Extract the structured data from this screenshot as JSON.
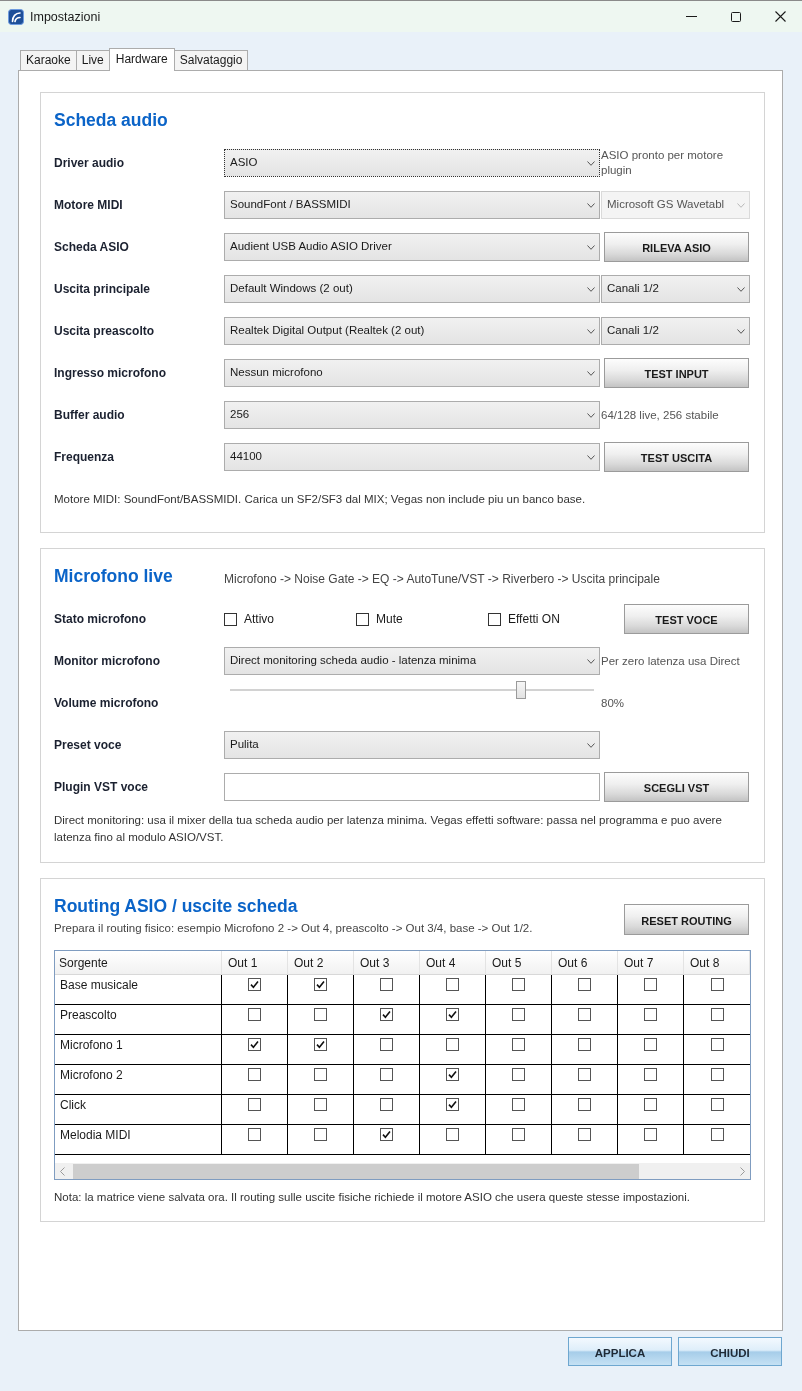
{
  "window": {
    "title": "Impostazioni"
  },
  "tabs": [
    {
      "label": "Karaoke",
      "selected": false
    },
    {
      "label": "Live",
      "selected": false
    },
    {
      "label": "Hardware",
      "selected": true
    },
    {
      "label": "Salvataggio",
      "selected": false
    }
  ],
  "sections": [
    {
      "kind": "form",
      "title": "Scheda audio",
      "rows": [
        {
          "label": "Driver audio",
          "control": {
            "kind": "dropdown",
            "value": "ASIO",
            "focused": true,
            "disabled": false
          },
          "side": {
            "kind": "note",
            "text": "ASIO pronto per motore plugin"
          }
        },
        {
          "label": "Motore MIDI",
          "control": {
            "kind": "dropdown",
            "value": "SoundFont / BASSMIDI",
            "focused": false,
            "disabled": false
          },
          "side": {
            "kind": "dropdown",
            "value": "Microsoft GS Wavetabl",
            "focused": false,
            "disabled": true
          }
        },
        {
          "label": "Scheda ASIO",
          "control": {
            "kind": "dropdown",
            "value": "Audient USB Audio ASIO Driver",
            "focused": false,
            "disabled": false
          },
          "side": {
            "kind": "button",
            "label": "RILEVA ASIO"
          }
        },
        {
          "label": "Uscita principale",
          "control": {
            "kind": "dropdown",
            "value": "Default Windows (2 out)",
            "focused": false,
            "disabled": false
          },
          "side": {
            "kind": "dropdown",
            "value": "Canali 1/2",
            "focused": false,
            "disabled": false
          }
        },
        {
          "label": "Uscita preascolto",
          "control": {
            "kind": "dropdown",
            "value": "Realtek Digital Output (Realtek (2 out)",
            "focused": false,
            "disabled": false
          },
          "side": {
            "kind": "dropdown",
            "value": "Canali 1/2",
            "focused": false,
            "disabled": false
          }
        },
        {
          "label": "Ingresso microfono",
          "control": {
            "kind": "dropdown",
            "value": "Nessun microfono",
            "focused": false,
            "disabled": false
          },
          "side": {
            "kind": "button",
            "label": "TEST INPUT"
          }
        },
        {
          "label": "Buffer audio",
          "control": {
            "kind": "dropdown",
            "value": "256",
            "focused": false,
            "disabled": false
          },
          "side": {
            "kind": "note",
            "text": "64/128 live, 256 stabile"
          }
        },
        {
          "label": "Frequenza",
          "control": {
            "kind": "dropdown",
            "value": "44100",
            "focused": false,
            "disabled": false
          },
          "side": {
            "kind": "button",
            "label": "TEST USCITA"
          }
        }
      ],
      "note": "Motore MIDI: SoundFont/BASSMIDI. Carica un SF2/SF3 dal MIX; Vegas non include piu un banco base."
    },
    {
      "kind": "form",
      "title": "Microfono live",
      "subtitle": "Microfono -> Noise Gate -> EQ -> AutoTune/VST -> Riverbero -> Uscita principale",
      "rows": [
        {
          "label": "Stato microfono",
          "control": {
            "kind": "checkboxes",
            "items": [
              {
                "label": "Attivo",
                "checked": false
              },
              {
                "label": "Mute",
                "checked": false
              },
              {
                "label": "Effetti ON",
                "checked": false
              }
            ]
          },
          "side": {
            "kind": "button",
            "label": "TEST VOCE"
          }
        },
        {
          "label": "Monitor microfono",
          "control": {
            "kind": "dropdown",
            "value": "Direct monitoring scheda audio - latenza minima",
            "focused": false,
            "disabled": false
          },
          "side": {
            "kind": "note",
            "text": "Per zero latenza usa Direct"
          }
        },
        {
          "label": "Volume microfono",
          "control": {
            "kind": "slider",
            "level": 0.8
          },
          "side": {
            "kind": "note",
            "text": "80%"
          }
        },
        {
          "label": "Preset voce",
          "control": {
            "kind": "dropdown",
            "value": "Pulita",
            "focused": false,
            "disabled": false
          }
        },
        {
          "label": "Plugin VST voce",
          "control": {
            "kind": "input"
          },
          "side": {
            "kind": "button",
            "label": "SCEGLI VST"
          }
        }
      ],
      "note": "Direct monitoring: usa il mixer della tua scheda audio per latenza minima. Vegas effetti software: passa nel programma e puo avere latenza fino al modulo ASIO/VST."
    },
    {
      "kind": "routing",
      "title": "Routing ASIO / uscite scheda",
      "subtitle": "Prepara il routing fisico: esempio Microfono 2 -> Out 4, preascolto -> Out 3/4, base -> Out 1/2.",
      "button": "RESET ROUTING",
      "table": {
        "columns": [
          "Sorgente",
          "Out 1",
          "Out 2",
          "Out 3",
          "Out 4",
          "Out 5",
          "Out 6",
          "Out 7",
          "Out 8"
        ],
        "rows": [
          {
            "source": "Base musicale",
            "cells": [
              {
                "checked": true
              },
              {
                "checked": true
              },
              {
                "checked": false
              },
              {
                "checked": false
              },
              {
                "checked": false
              },
              {
                "checked": false
              },
              {
                "checked": false
              },
              {
                "checked": false
              }
            ]
          },
          {
            "source": "Preascolto",
            "cells": [
              {
                "checked": false
              },
              {
                "checked": false
              },
              {
                "checked": true
              },
              {
                "checked": true
              },
              {
                "checked": false
              },
              {
                "checked": false
              },
              {
                "checked": false
              },
              {
                "checked": false
              }
            ]
          },
          {
            "source": "Microfono 1",
            "cells": [
              {
                "checked": true
              },
              {
                "checked": true
              },
              {
                "checked": false
              },
              {
                "checked": false
              },
              {
                "checked": false
              },
              {
                "checked": false
              },
              {
                "checked": false
              },
              {
                "checked": false
              }
            ]
          },
          {
            "source": "Microfono 2",
            "cells": [
              {
                "checked": false
              },
              {
                "checked": false
              },
              {
                "checked": false
              },
              {
                "checked": true
              },
              {
                "checked": false
              },
              {
                "checked": false
              },
              {
                "checked": false
              },
              {
                "checked": false
              }
            ]
          },
          {
            "source": "Click",
            "cells": [
              {
                "checked": false
              },
              {
                "checked": false
              },
              {
                "checked": false
              },
              {
                "checked": true
              },
              {
                "checked": false
              },
              {
                "checked": false
              },
              {
                "checked": false
              },
              {
                "checked": false
              }
            ]
          },
          {
            "source": "Melodia MIDI",
            "cells": [
              {
                "checked": false
              },
              {
                "checked": false
              },
              {
                "checked": true
              },
              {
                "checked": false
              },
              {
                "checked": false
              },
              {
                "checked": false
              },
              {
                "checked": false
              },
              {
                "checked": false
              }
            ]
          }
        ]
      },
      "note": "Nota: la matrice viene salvata ora. Il routing sulle uscite fisiche richiede il motore ASIO che usera queste stesse impostazioni."
    }
  ],
  "buttons": [
    "APPLICA",
    "CHIUDI"
  ]
}
